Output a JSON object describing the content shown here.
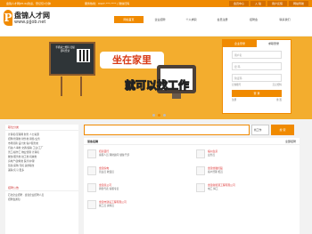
{
  "topbar": {
    "welcome": "盘锦人才网[Pt.ib]欢迎，登记仅1分钟",
    "hotline": "服务热线：0427-***-**** | 微信扫码",
    "links": [
      "会员中心",
      "入 驻",
      "用户反馈",
      "网站导航"
    ]
  },
  "logo": {
    "name": "盘锦人才网",
    "url": "www.pjjob.net"
  },
  "nav": [
    "网站首页",
    "企业招聘",
    "个人求职",
    "会员注册",
    "招聘会",
    "联系我们"
  ],
  "banner": {
    "board_text": "手机站二维码 扫描即可登录",
    "slogan_1": "坐在家里",
    "slogan_2": "就可以找工作"
  },
  "login": {
    "tabs": [
      "企业登录",
      "求职登录"
    ],
    "username_placeholder": "用户名",
    "password_placeholder": "密 码",
    "code_placeholder": "验证码",
    "remember": "记住账号",
    "forgot": "忘记密码",
    "login_button": "登 录",
    "register": "注册",
    "reset": "重 置"
  },
  "sidebar": {
    "title": "职位分类",
    "lines": [
      "计算机/互联网  财务  人力资源",
      "招聘/管理类  财务类  销售/业务",
      "市场营销  设计类  客户服务类",
      "行政/人事类  交通/运输  工业/工厂",
      "普工/操作工  物业管理  计算机",
      "餐饮/服务类  技工类  机械类",
      "房地产/建筑类  医疗/护理",
      "贸易/采购  司机  其他职位",
      "兼职/实习  更多"
    ],
    "news_title": "招聘公告",
    "news": [
      "石化企业招聘 · 盘锦企业招聘人员",
      "招聘会通知"
    ]
  },
  "search": {
    "placeholder": "",
    "select_value": "找工作",
    "button": "搜 索"
  },
  "jobs": {
    "title": "紧急招聘",
    "more": "全部招聘",
    "companies": [
      {
        "name": "招商银行",
        "jobs": "客服人员 理财顾问 储备干部"
      },
      {
        "name": "盘锦家电",
        "jobs": "营业员 收银员"
      },
      {
        "name": "盘锦某公司",
        "jobs": "销售代表 客服专员"
      },
      {
        "name": "盘锦市建设工程有限公司",
        "jobs": "施工员 资料员"
      },
      {
        "name": "福州生意",
        "jobs": "业务员"
      },
      {
        "name": "盘锦金融控股",
        "jobs": "客户经理 柜员"
      },
      {
        "name": "盘锦新能源工程有限公司",
        "jobs": "电工 焊工"
      },
      {
        "name": "",
        "jobs": ""
      }
    ]
  }
}
